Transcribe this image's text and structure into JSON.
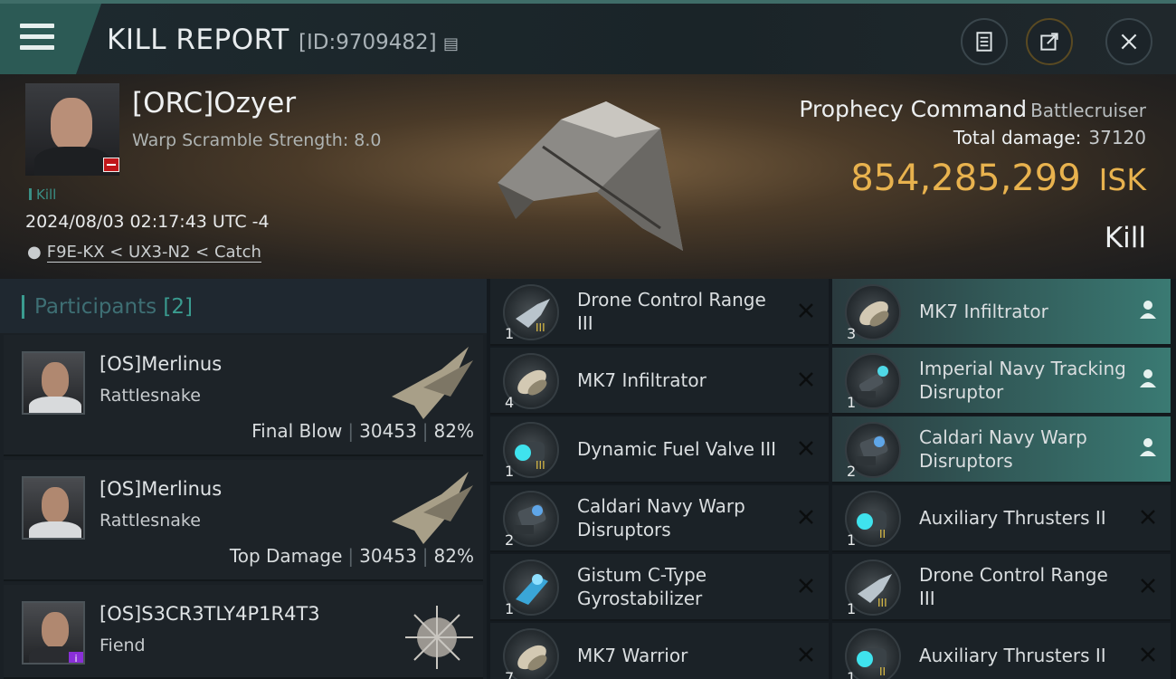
{
  "header": {
    "title": "KILL REPORT",
    "report_id": "[ID:9709482]"
  },
  "victim": {
    "name": "[ORC]Ozyer",
    "warp_scramble": "Warp Scramble Strength: 8.0",
    "kill_tag": "Kill",
    "datetime": "2024/08/03 02:17:43 UTC -4",
    "location": "F9E-KX < UX3-N2 < Catch",
    "ship_name": "Prophecy Command",
    "ship_class": "Battlecruiser",
    "total_damage_label": "Total damage:",
    "total_damage": "37120",
    "isk_value": "854,285,299",
    "isk_unit": "ISK",
    "result": "Kill"
  },
  "participants": {
    "label": "Participants",
    "count": "[2]",
    "items": [
      {
        "name": "[OS]Merlinus",
        "ship": "Rattlesnake",
        "role": "Final Blow",
        "damage": "30453",
        "percent": "82%"
      },
      {
        "name": "[OS]Merlinus",
        "ship": "Rattlesnake",
        "role": "Top Damage",
        "damage": "30453",
        "percent": "82%"
      },
      {
        "name": "[OS]S3CR3TLY4P1R4T3",
        "ship": "Fiend",
        "role": "",
        "damage": "",
        "percent": ""
      }
    ]
  },
  "items_left": [
    {
      "qty": "1",
      "name": "Drone Control Range III",
      "icon": "drone-range-icon"
    },
    {
      "qty": "4",
      "name": "MK7  Infiltrator",
      "icon": "drone-icon"
    },
    {
      "qty": "1",
      "name": "Dynamic Fuel Valve III",
      "icon": "fuel-valve-icon"
    },
    {
      "qty": "2",
      "name": "Caldari Navy Warp Disruptors",
      "icon": "warp-disruptor-icon"
    },
    {
      "qty": "1",
      "name": "Gistum C-Type Gyrostabilizer",
      "icon": "gyrostabilizer-icon"
    },
    {
      "qty": "7",
      "name": "MK7  Warrior",
      "icon": "drone-icon"
    }
  ],
  "items_right": [
    {
      "qty": "3",
      "name": "MK7  Infiltrator",
      "icon": "drone-icon",
      "highlight": true
    },
    {
      "qty": "1",
      "name": "Imperial Navy Tracking Disruptor",
      "icon": "tracking-disruptor-icon",
      "highlight": true
    },
    {
      "qty": "2",
      "name": "Caldari Navy Warp Disruptors",
      "icon": "warp-disruptor-icon",
      "highlight": true
    },
    {
      "qty": "1",
      "name": "Auxiliary Thrusters II",
      "icon": "thruster-icon",
      "highlight": false
    },
    {
      "qty": "1",
      "name": "Drone Control Range III",
      "icon": "drone-range-icon",
      "highlight": false
    },
    {
      "qty": "1",
      "name": "Auxiliary Thrusters II",
      "icon": "thruster-icon",
      "highlight": false
    }
  ],
  "colors": {
    "accent": "#3a8f85",
    "isk": "#e8b24e",
    "highlight": "#3a7a73"
  }
}
